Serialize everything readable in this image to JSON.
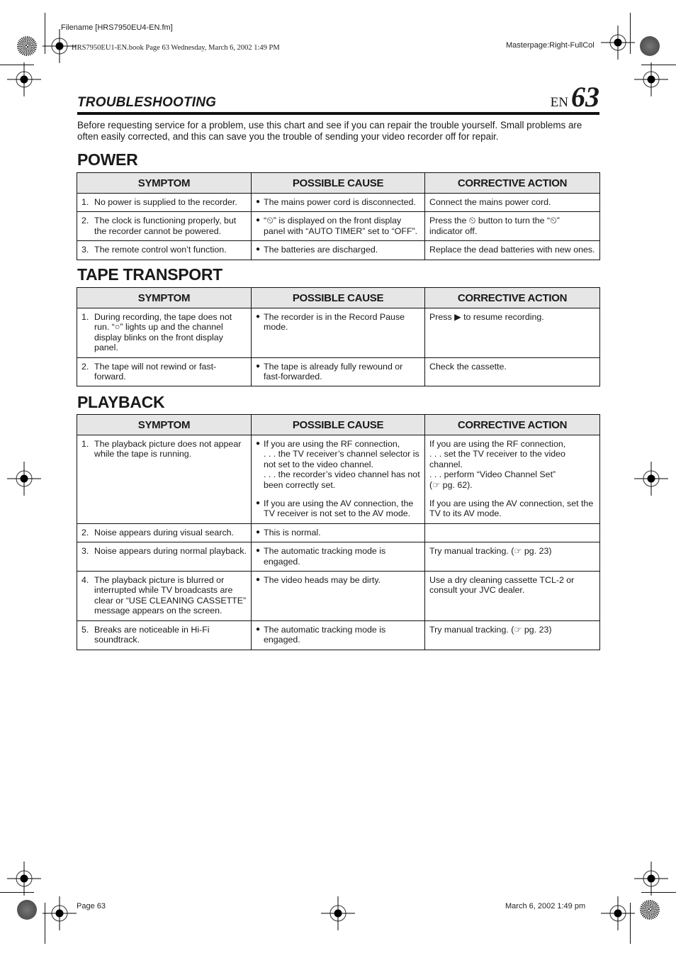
{
  "print_header": {
    "filename": "Filename [HRS7950EU4-EN.fm]",
    "book_info": "HRS7950EU1-EN.book  Page 63  Wednesday, March 6, 2002  1:49 PM",
    "masterpage": "Masterpage:Right-FullCol"
  },
  "page": {
    "section_title": "TROUBLESHOOTING",
    "lang": "EN",
    "number": "63",
    "intro": "Before requesting service for a problem, use this chart and see if you can repair the trouble yourself. Small problems are often easily corrected, and this can save you the trouble of sending your video recorder off for repair."
  },
  "columns": {
    "symptom": "SYMPTOM",
    "cause": "POSSIBLE CAUSE",
    "action": "CORRECTIVE ACTION"
  },
  "power": {
    "title": "POWER",
    "rows": [
      {
        "n": "1.",
        "symptom": "No power is supplied to the recorder.",
        "cause": [
          "The mains power cord is disconnected."
        ],
        "action": [
          "Connect the mains power cord."
        ]
      },
      {
        "n": "2.",
        "symptom": "The clock is functioning properly, but the recorder cannot be powered.",
        "cause": [
          "“⏲” is displayed on the front display panel with “AUTO TIMER” set to “OFF”."
        ],
        "action": [
          "Press the ⏲ button to turn the “⏲” indicator off."
        ]
      },
      {
        "n": "3.",
        "symptom": "The remote control won’t function.",
        "cause": [
          "The batteries are discharged."
        ],
        "action": [
          "Replace the dead batteries with new ones."
        ]
      }
    ]
  },
  "tape_transport": {
    "title": "TAPE TRANSPORT",
    "rows": [
      {
        "n": "1.",
        "symptom": "During recording, the tape does not run. “○” lights up and the channel display blinks on the front display panel.",
        "cause": [
          "The recorder is in the Record Pause mode."
        ],
        "action": [
          "Press ▶ to resume recording."
        ]
      },
      {
        "n": "2.",
        "symptom": "The tape will not rewind or fast-forward.",
        "cause": [
          "The tape is already fully rewound or fast-forwarded."
        ],
        "action": [
          "Check the cassette."
        ]
      }
    ]
  },
  "playback": {
    "title": "PLAYBACK",
    "rows": [
      {
        "n": "1.",
        "symptom": "The playback picture does not appear while the tape is running.",
        "cause": [
          "If you are using the RF connection,\n. . . the TV receiver’s channel selector is not set to the video channel.\n. . . the recorder’s video channel has not been correctly set.",
          "If you are using the AV connection, the TV receiver is not set to the AV mode."
        ],
        "action": [
          "If you are using the RF connection,\n. . . set the TV receiver to the video channel.\n. . . perform “Video Channel Set”\n(☞ pg. 62).",
          "If you are using the AV connection, set the TV to its AV mode."
        ]
      },
      {
        "n": "2.",
        "symptom": "Noise appears during visual search.",
        "cause": [
          "This is normal."
        ],
        "action": [
          ""
        ]
      },
      {
        "n": "3.",
        "symptom": "Noise appears during normal playback.",
        "cause": [
          "The automatic tracking mode is engaged."
        ],
        "action": [
          "Try manual tracking. (☞ pg. 23)"
        ]
      },
      {
        "n": "4.",
        "symptom": "The playback picture is blurred or interrupted while TV broadcasts are clear or “USE CLEANING CASSETTE” message appears on the screen.",
        "cause": [
          "The video heads may be dirty."
        ],
        "action": [
          "Use a dry cleaning cassette TCL-2 or consult your JVC dealer."
        ]
      },
      {
        "n": "5.",
        "symptom": "Breaks are noticeable in Hi-Fi soundtrack.",
        "cause": [
          "The automatic tracking mode is engaged."
        ],
        "action": [
          "Try manual tracking. (☞ pg. 23)"
        ]
      }
    ]
  },
  "print_footer": {
    "page": "Page 63",
    "date": "March 6, 2002 1:49 pm"
  },
  "bullet": "●"
}
